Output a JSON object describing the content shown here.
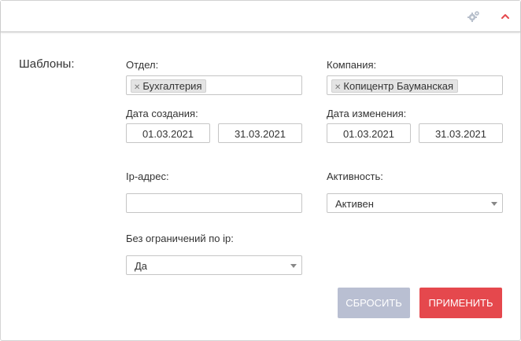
{
  "header": {
    "settings_icon": "gears-icon",
    "collapse_icon": "chevron-up-icon",
    "accent_color": "#e5484d"
  },
  "filters": {
    "section_title": "Шаблоны:",
    "department": {
      "label": "Отдел:",
      "tags": [
        "Бухгалтерия"
      ]
    },
    "company": {
      "label": "Компания:",
      "tags": [
        "Копицентр Бауманская"
      ]
    },
    "created": {
      "label": "Дата создания:",
      "from": "01.03.2021",
      "to": "31.03.2021"
    },
    "modified": {
      "label": "Дата изменения:",
      "from": "01.03.2021",
      "to": "31.03.2021"
    },
    "ip": {
      "label": "Ip-адрес:",
      "value": ""
    },
    "activity": {
      "label": "Активность:",
      "selected": "Активен"
    },
    "ip_unlimited": {
      "label": "Без ограничений по ip:",
      "selected": "Да"
    }
  },
  "actions": {
    "reset_label": "СБРОСИТЬ",
    "apply_label": "ПРИМЕНИТЬ",
    "reset_color": "#b9bfd2",
    "apply_color": "#e5484d"
  }
}
